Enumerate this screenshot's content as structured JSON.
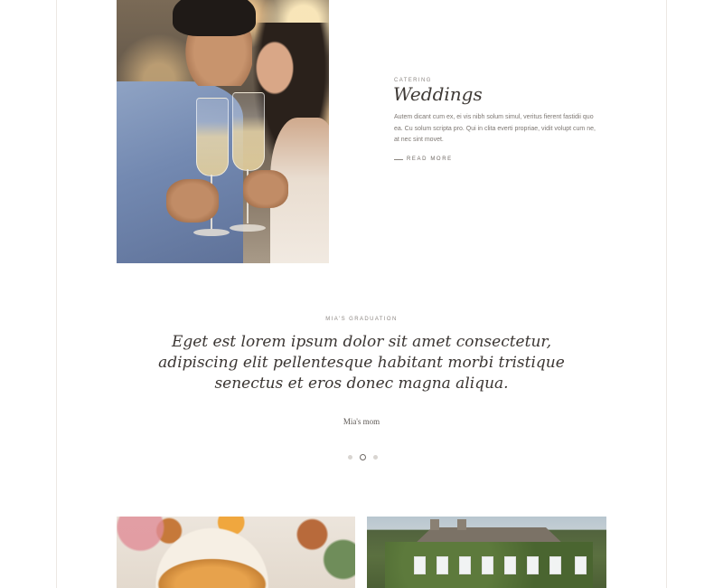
{
  "feature": {
    "kicker": "CATERING",
    "title": "Weddings",
    "description": "Autem dicant cum ex, ei vis nibh solum simul, veritus fierent fastidii quo ea. Cu solum scripta pro. Qui in clita everti propriae, vidit volupt cum ne, at nec sint movet.",
    "read_more": "READ MORE"
  },
  "testimonial": {
    "kicker": "MIA'S GRADUATION",
    "quote": "Eget est lorem ipsum dolor sit amet consectetur, adipiscing elit pellentesque habitant morbi tristique senectus et eros donec magna aliqua.",
    "author": "Mia's mom",
    "slides_total": 3,
    "active_slide": 2
  }
}
